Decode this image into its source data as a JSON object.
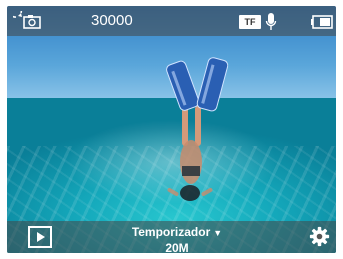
{
  "status_bar": {
    "shot_count": "30000",
    "storage_label": "TF",
    "icons": [
      "photo-mode-icon",
      "microphone-icon",
      "battery-icon"
    ]
  },
  "bottom_bar": {
    "mode_label": "Temporizador",
    "mode_caret": "▼",
    "resolution": "20M",
    "icons": [
      "playback-icon",
      "settings-icon"
    ]
  },
  "colors": {
    "bar_overlay": "#464646",
    "text": "#ffffff"
  }
}
